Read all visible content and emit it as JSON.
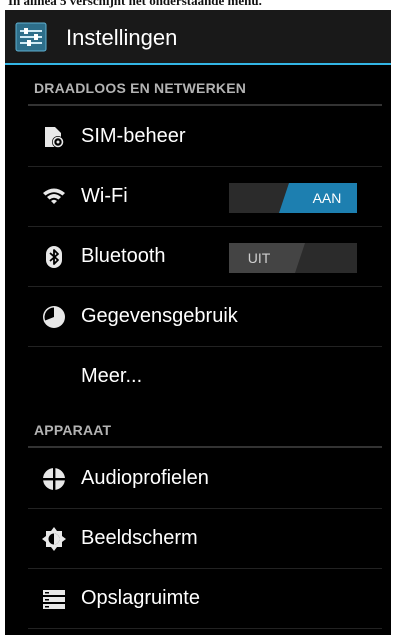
{
  "caption": "In alinea 5 verschijnt het onderstaande menu.",
  "actionbar": {
    "title": "Instellingen",
    "icon": "settings-sliders-icon"
  },
  "sections": [
    {
      "header": "DRAADLOOS EN NETWERKEN",
      "items": [
        {
          "label": "SIM-beheer",
          "icon": "sim-card-icon"
        },
        {
          "label": "Wi-Fi",
          "icon": "wifi-icon",
          "toggle": {
            "state": "on",
            "label": "AAN"
          }
        },
        {
          "label": "Bluetooth",
          "icon": "bluetooth-icon",
          "toggle": {
            "state": "off",
            "label": "UIT"
          }
        },
        {
          "label": "Gegevensgebruik",
          "icon": "data-usage-icon"
        },
        {
          "label": "Meer..."
        }
      ]
    },
    {
      "header": "APPARAAT",
      "items": [
        {
          "label": "Audioprofielen",
          "icon": "audio-profiles-icon"
        },
        {
          "label": "Beeldscherm",
          "icon": "display-icon"
        },
        {
          "label": "Opslagruimte",
          "icon": "storage-icon"
        }
      ]
    }
  ],
  "colors": {
    "accent": "#33b5e5",
    "background": "#000000",
    "actionbar": "#191919",
    "section_header": "#b3b3b3",
    "text": "#ffffff"
  }
}
